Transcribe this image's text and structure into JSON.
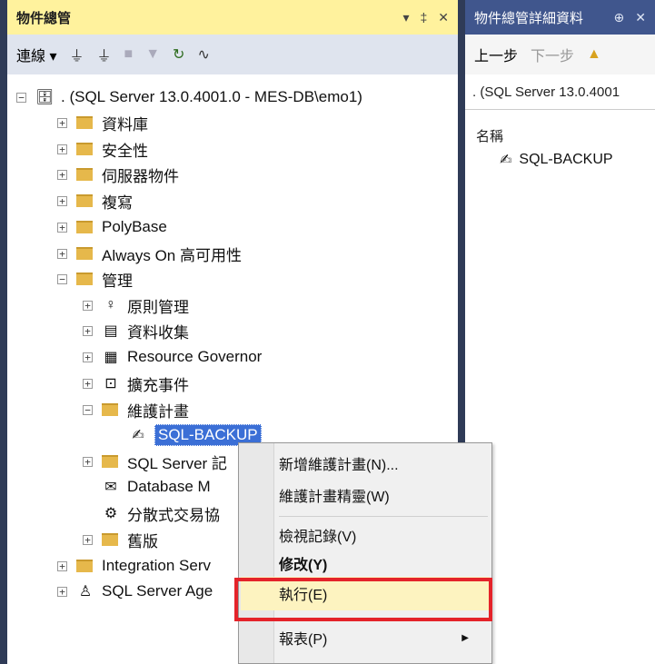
{
  "object_explorer": {
    "title": "物件總管",
    "title_buttons": [
      "▾",
      "‡",
      "✕"
    ],
    "toolbar": {
      "connect_label": "連線 ▾"
    },
    "tree": [
      {
        "label": ". (SQL Server 13.0.4001.0 - MES-DB\\emo1)",
        "expander": "−",
        "icon": "server-icon"
      },
      {
        "label": "資料庫",
        "expander": "+",
        "icon": "folder-icon"
      },
      {
        "label": "安全性",
        "expander": "+",
        "icon": "folder-icon"
      },
      {
        "label": "伺服器物件",
        "expander": "+",
        "icon": "folder-icon"
      },
      {
        "label": "複寫",
        "expander": "+",
        "icon": "folder-icon"
      },
      {
        "label": "PolyBase",
        "expander": "+",
        "icon": "folder-icon"
      },
      {
        "label": "Always On 高可用性",
        "expander": "+",
        "icon": "folder-icon"
      },
      {
        "label": "管理",
        "expander": "−",
        "icon": "folder-icon"
      },
      {
        "label": "原則管理",
        "expander": "+",
        "icon": "policy-icon"
      },
      {
        "label": "資料收集",
        "expander": "+",
        "icon": "data-collection-icon"
      },
      {
        "label": "Resource Governor",
        "expander": "+",
        "icon": "resource-governor-icon"
      },
      {
        "label": "擴充事件",
        "expander": "+",
        "icon": "extended-events-icon"
      },
      {
        "label": "維護計畫",
        "expander": "−",
        "icon": "folder-icon"
      },
      {
        "label": "SQL-BACKUP",
        "expander": "",
        "icon": "maintenance-plan-icon",
        "selected": true
      },
      {
        "label": "SQL Server 記",
        "expander": "+",
        "icon": "folder-icon"
      },
      {
        "label": "Database M",
        "expander": "",
        "icon": "database-mail-icon"
      },
      {
        "label": "分散式交易協",
        "expander": "",
        "icon": "dtc-icon"
      },
      {
        "label": "舊版",
        "expander": "+",
        "icon": "folder-icon"
      },
      {
        "label": "Integration Serv",
        "expander": "+",
        "icon": "folder-icon"
      },
      {
        "label": "SQL Server Age",
        "expander": "+",
        "icon": "agent-icon"
      }
    ]
  },
  "details": {
    "title": "物件總管詳細資料",
    "title_buttons": [
      "⊕",
      "✕"
    ],
    "toolbar": {
      "back_label": "上一步",
      "forward_label": "下一步"
    },
    "path": ". (SQL Server 13.0.4001",
    "column_name": "名稱",
    "items": [
      "SQL-BACKUP"
    ]
  },
  "context_menu": {
    "items": [
      {
        "label": "新增維護計畫(N)...",
        "bold": false
      },
      {
        "label": "維護計畫精靈(W)",
        "bold": false
      },
      {
        "label": "檢視記錄(V)",
        "bold": false
      },
      {
        "label": "修改(Y)",
        "bold": true
      },
      {
        "label": "執行(E)",
        "bold": false,
        "highlighted": true
      },
      {
        "label": "報表(P)",
        "bold": false,
        "submenu": true
      }
    ]
  },
  "colors": {
    "frame": "#2f3b57",
    "oe_title_bg": "#fff29d",
    "details_title_bg": "#40568d",
    "selection": "#3b6fd6",
    "highlight_box": "#e4232a"
  }
}
